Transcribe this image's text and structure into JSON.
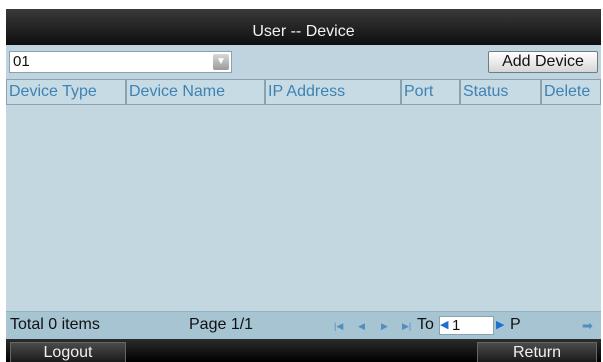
{
  "window": {
    "title": "User -- Device"
  },
  "user_select": {
    "value": "01",
    "arrow_icon": "chevron-down-icon"
  },
  "toolbar": {
    "add_device_label": "Add Device"
  },
  "table": {
    "columns": [
      "Device Type",
      "Device Name",
      "IP Address",
      "Port",
      "Status",
      "Delete"
    ],
    "rows": []
  },
  "footer": {
    "total": "Total 0 items",
    "page": "Page 1/1",
    "goto_label": "To",
    "goto_value": "1",
    "page_unit": "P"
  },
  "bottom": {
    "logout_label": "Logout",
    "return_label": "Return"
  },
  "colors": {
    "panel_bg": "#bfd4de",
    "header_text": "#3e82b4",
    "footer_bg": "#a7c4d3",
    "titlebar_bg": "#1a1a1a"
  }
}
